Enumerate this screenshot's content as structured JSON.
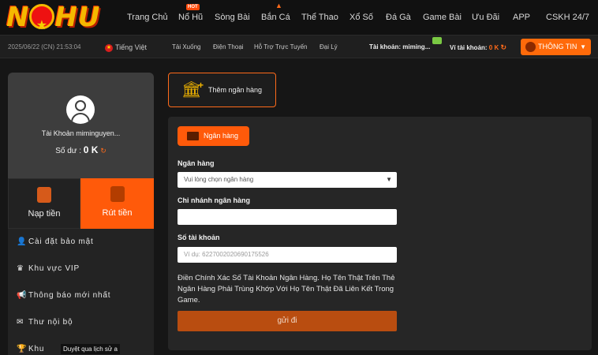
{
  "brand": {
    "logo_text_1": "N",
    "logo_text_2": "HU",
    "logo_star": "★"
  },
  "nav": {
    "items": [
      {
        "label": "Trang Chủ"
      },
      {
        "label": "Nổ Hũ",
        "badge": "HOT"
      },
      {
        "label": "Sòng Bài"
      },
      {
        "label": "Bắn Cá"
      },
      {
        "label": "Thể Thao"
      },
      {
        "label": "Xổ Số"
      },
      {
        "label": "Đá Gà"
      },
      {
        "label": "Game Bài"
      },
      {
        "label": "Ưu Đãi"
      },
      {
        "label": "APP"
      },
      {
        "label": "CSKH 24/7"
      }
    ]
  },
  "subbar": {
    "datetime": "2025/06/22 (CN) 21:53:04",
    "language": "Tiếng Việt",
    "links": [
      "Tải Xuống",
      "Điện Thoại",
      "Hỗ Trợ Trực Tuyến",
      "Đại Lý"
    ],
    "account_label": "Tài khoản:",
    "account_value": "miming...",
    "wallet_label": "Ví tài khoản:",
    "wallet_value": "0 K",
    "info_button": "THÔNG TIN"
  },
  "profile": {
    "account_name": "Tài Khoản miminguyen...",
    "balance_label": "Số dư :",
    "balance_value": "0 K"
  },
  "side_tabs": {
    "deposit": "Nạp tiền",
    "withdraw": "Rút tiền"
  },
  "menu": {
    "items": [
      "Cài đặt bảo mật",
      "Khu vực VIP",
      "Thông báo mới nhất",
      "Thư nội bộ",
      "Khu"
    ],
    "tooltip": "Duyệt qua lịch sử a"
  },
  "main": {
    "add_bank": "Thêm ngân hàng",
    "bank_tab": "Ngân hàng",
    "fields": {
      "bank_label": "Ngân hàng",
      "bank_placeholder": "Vui lòng chọn ngân hàng",
      "branch_label": "Chi nhánh ngân hàng",
      "branch_value": "",
      "account_label": "Số tài khoản",
      "account_placeholder": "Ví dụ:  6227002020690175526"
    },
    "note": "Điền Chính Xác Số Tài Khoản Ngân Hàng. Họ Tên Thật Trên Thẻ Ngân Hàng Phải Trùng Khớp Với Họ Tên Thật Đã Liên Kết Trong Game.",
    "submit": "gửi đi"
  },
  "colors": {
    "accent": "#ff5a0a",
    "background": "#161616",
    "panel": "#262626",
    "gold": "#f5b800"
  }
}
